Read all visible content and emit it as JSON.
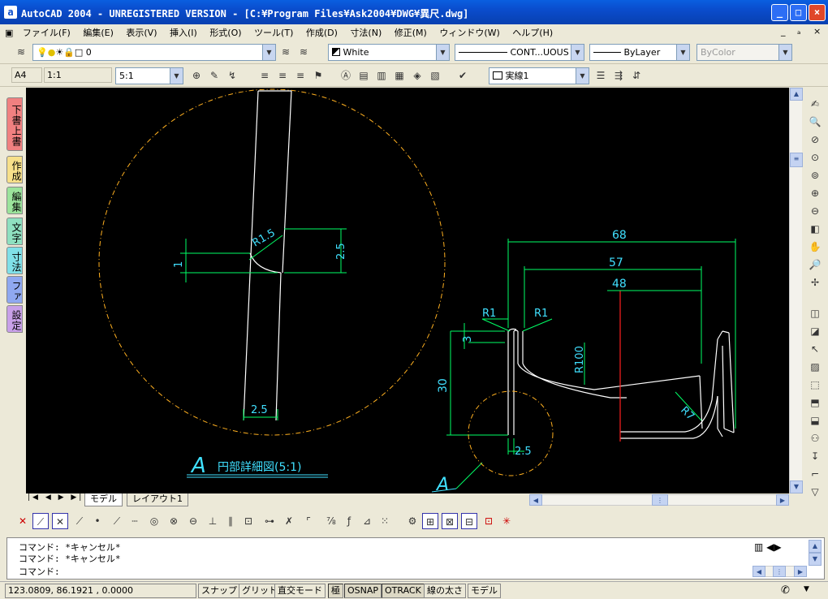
{
  "window": {
    "title": "AutoCAD 2004 - UNREGISTERED VERSION - [C:¥Program Files¥Ask2004¥DWG¥異尺.dwg]",
    "buttons": {
      "minimize": "_",
      "maximize": "□",
      "close": "×"
    }
  },
  "menu": {
    "items": [
      "ファイル(F)",
      "編集(E)",
      "表示(V)",
      "挿入(I)",
      "形式(O)",
      "ツール(T)",
      "作成(D)",
      "寸法(N)",
      "修正(M)",
      "ウィンドウ(W)",
      "ヘルプ(H)"
    ],
    "mdi": [
      "_",
      "ₐ",
      "×"
    ]
  },
  "layers_toolbar": {
    "layer_value": "0",
    "color_value": "White",
    "linetype_value": "CONT...UOUS",
    "lineweight_value": "ByLayer",
    "plotstyle_value": "ByColor"
  },
  "dim_toolbar": {
    "paper_size": "A4",
    "scale_ratio": "1:1",
    "scale_combo": "5:1",
    "linestyle_combo": "実線1"
  },
  "left_tabs": [
    {
      "label": "下書上書",
      "color": "#f08080"
    },
    {
      "label": "作成",
      "color": "#f7e08a"
    },
    {
      "label": "編集",
      "color": "#9be39b"
    },
    {
      "label": "文字",
      "color": "#8fe0c0"
    },
    {
      "label": "寸法",
      "color": "#80e0e8"
    },
    {
      "label": "ファ",
      "color": "#8fa8f0"
    },
    {
      "label": "設定",
      "color": "#c8a0e8"
    }
  ],
  "drawing": {
    "detail_title_letter": "A",
    "detail_title_text": "円部詳細図(5:1)",
    "callout_letter": "A",
    "dims_detail": {
      "r1_5": "R1.5",
      "d2_5_vertical": "2.5",
      "d1": "1",
      "d2_5_bottom": "2.5"
    },
    "dims_main": {
      "d68": "68",
      "d57": "57",
      "d48": "48",
      "r1_left": "R1",
      "r1_right": "R1",
      "d3": "3",
      "r100": "R100",
      "d30": "30",
      "r7": "R7",
      "d2_5": "2.5"
    },
    "colors": {
      "background": "#000000",
      "outline": "#ffffff",
      "dimension": "#00ff66",
      "detail_circle": "#ffb020",
      "dim_text": "#40e0ff",
      "center_line": "#ff2020"
    }
  },
  "layout_tabs": [
    "モデル",
    "レイアウト1"
  ],
  "command": {
    "lines": [
      "コマンド: *キャンセル*",
      "コマンド: *キャンセル*",
      "コマンド:"
    ]
  },
  "status": {
    "coords": "123.0809, 86.1921 , 0.0000",
    "toggles": [
      {
        "label": "スナップ",
        "on": false
      },
      {
        "label": "グリッド",
        "on": false
      },
      {
        "label": "直交モード",
        "on": false
      },
      {
        "label": "極",
        "on": true
      },
      {
        "label": "OSNAP",
        "on": true
      },
      {
        "label": "OTRACK",
        "on": true
      },
      {
        "label": "線の太さ",
        "on": false
      },
      {
        "label": "モデル",
        "on": false
      }
    ]
  }
}
